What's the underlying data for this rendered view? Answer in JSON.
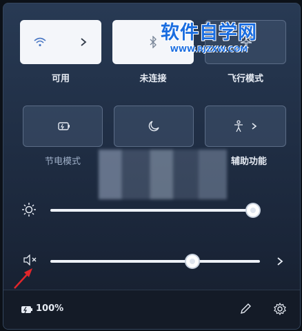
{
  "watermark": {
    "title": "软件自学网",
    "url": "WWW.RJZXW.COM"
  },
  "tiles": [
    {
      "label": "可用",
      "on": true,
      "icon": "wifi-icon",
      "has_chevron": true
    },
    {
      "label": "未连接",
      "on": true,
      "icon": "bluetooth-icon",
      "has_chevron": false
    },
    {
      "label": "飞行模式",
      "on": false,
      "icon": "airplane-icon",
      "has_chevron": false
    },
    {
      "label": "节电模式",
      "on": false,
      "icon": "battery-saver-icon",
      "has_chevron": false
    },
    {
      "label": "",
      "on": false,
      "icon": "moon-icon",
      "has_chevron": false
    },
    {
      "label": "辅助功能",
      "on": false,
      "icon": "accessibility-icon",
      "has_chevron": true
    }
  ],
  "brightness": {
    "level_percent": 100
  },
  "volume": {
    "level_percent": 73,
    "muted": true
  },
  "footer": {
    "battery_text": "100%"
  },
  "colors": {
    "accent_on": "#f4f6fa",
    "annotation_arrow": "#e0262b",
    "watermark": "#1a6de0"
  }
}
